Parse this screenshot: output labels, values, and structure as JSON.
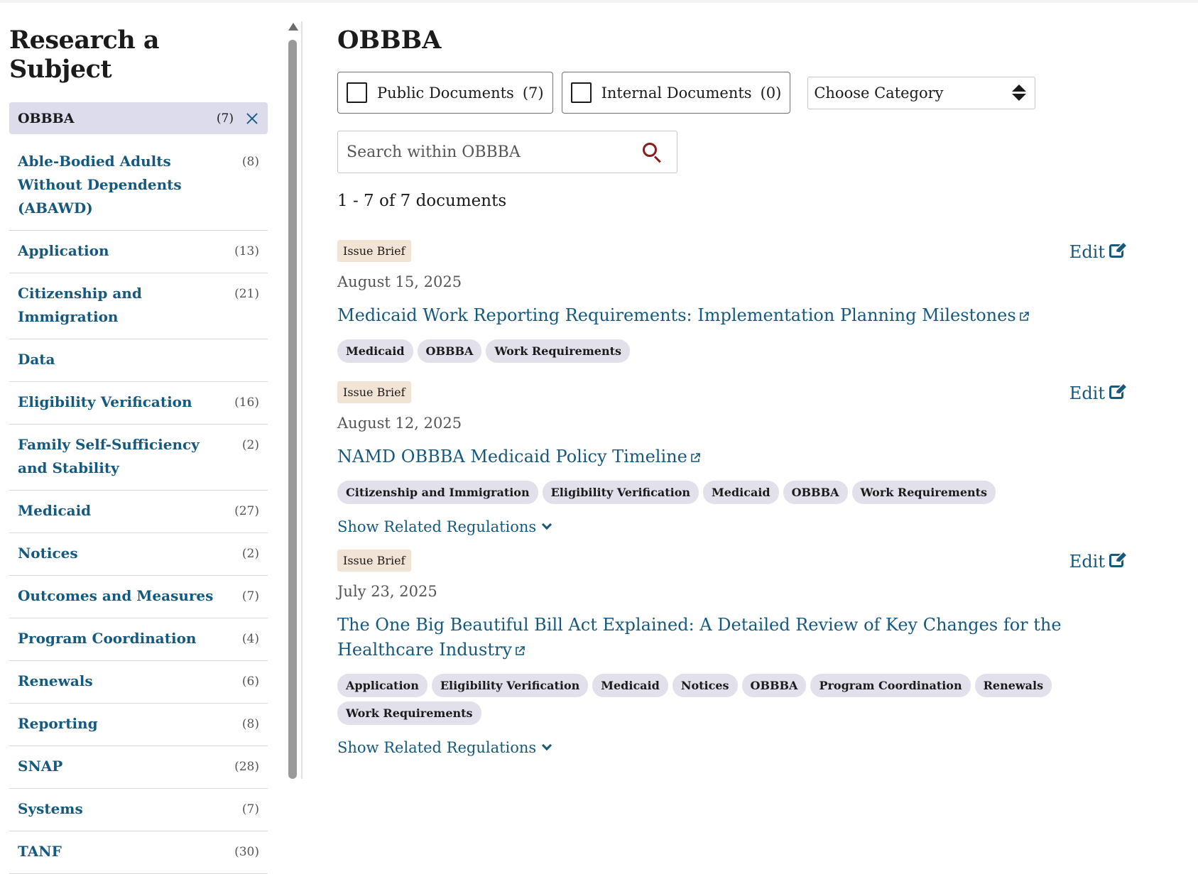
{
  "sidebar": {
    "title": "Research a Subject",
    "selected": {
      "label": "OBBBA",
      "count": "(7)"
    },
    "items": [
      {
        "label": "Able-Bodied Adults Without Dependents (ABAWD)",
        "count": "(8)"
      },
      {
        "label": "Application",
        "count": "(13)"
      },
      {
        "label": "Citizenship and Immigration",
        "count": "(21)"
      },
      {
        "label": "Data",
        "count": ""
      },
      {
        "label": "Eligibility Verification",
        "count": "(16)"
      },
      {
        "label": "Family Self-Sufficiency and Stability",
        "count": "(2)"
      },
      {
        "label": "Medicaid",
        "count": "(27)"
      },
      {
        "label": "Notices",
        "count": "(2)"
      },
      {
        "label": "Outcomes and Measures",
        "count": "(7)"
      },
      {
        "label": "Program Coordination",
        "count": "(4)"
      },
      {
        "label": "Renewals",
        "count": "(6)"
      },
      {
        "label": "Reporting",
        "count": "(8)"
      },
      {
        "label": "SNAP",
        "count": "(28)"
      },
      {
        "label": "Systems",
        "count": "(7)"
      },
      {
        "label": "TANF",
        "count": "(30)"
      }
    ]
  },
  "main": {
    "title": "OBBBA",
    "filters": {
      "public": {
        "label": "Public Documents",
        "count": "(7)"
      },
      "internal": {
        "label": "Internal Documents",
        "count": "(0)"
      },
      "category_select": "Choose Category"
    },
    "search": {
      "placeholder": "Search within OBBBA"
    },
    "result_count": "1 - 7 of 7 documents",
    "edit_label": "Edit",
    "related_label": "Show Related Regulations",
    "documents": [
      {
        "type": "Issue Brief",
        "date": "August 15, 2025",
        "title": "Medicaid Work Reporting Requirements: Implementation Planning Milestones",
        "tags": [
          "Medicaid",
          "OBBBA",
          "Work Requirements"
        ],
        "has_related": false
      },
      {
        "type": "Issue Brief",
        "date": "August 12, 2025",
        "title": "NAMD OBBBA Medicaid Policy Timeline",
        "tags": [
          "Citizenship and Immigration",
          "Eligibility Verification",
          "Medicaid",
          "OBBBA",
          "Work Requirements"
        ],
        "has_related": true
      },
      {
        "type": "Issue Brief",
        "date": "July 23, 2025",
        "title": "The One Big Beautiful Bill Act Explained: A Detailed Review of Key Changes for the Healthcare Industry",
        "tags": [
          "Application",
          "Eligibility Verification",
          "Medicaid",
          "Notices",
          "OBBBA",
          "Program Coordination",
          "Renewals",
          "Work Requirements"
        ],
        "has_related": true
      }
    ]
  },
  "colors": {
    "link": "#15597f",
    "chip": "#dcdcec",
    "tag": "#e2e0ea",
    "doc_type": "#f1e4d5",
    "search_icon": "#8a1c1c"
  }
}
